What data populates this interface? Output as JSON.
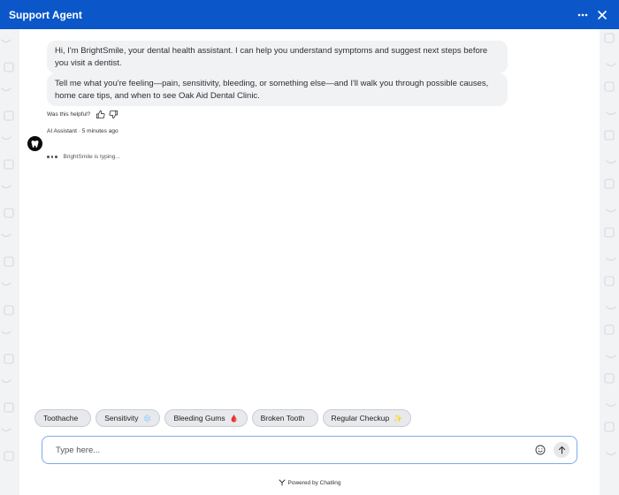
{
  "header": {
    "title": "Support Agent",
    "more_icon": "more-horizontal-icon",
    "close_icon": "close-icon"
  },
  "messages": [
    {
      "text": "Hi, I'm BrightSmile, your dental health assistant. I can help you understand symptoms and suggest next steps before you visit a dentist."
    },
    {
      "text": "Tell me what you're feeling—pain, sensitivity, bleeding, or something else—and I'll walk you through possible causes, home care tips, and when to see Oak Aid Dental Clinic."
    }
  ],
  "feedback": {
    "label": "Was this helpful?"
  },
  "meta": {
    "sender": "AI Assistant · 5 minutes ago"
  },
  "typing": {
    "text": "BrightSmile is typing..."
  },
  "chips": [
    {
      "label": "Toothache",
      "emoji": ""
    },
    {
      "label": "Sensitivity",
      "emoji": "❄️"
    },
    {
      "label": "Bleeding Gums",
      "emoji": "🩸"
    },
    {
      "label": "Broken Tooth",
      "emoji": ""
    },
    {
      "label": "Regular Checkup",
      "emoji": "✨"
    }
  ],
  "input": {
    "placeholder": "Type here..."
  },
  "footer": {
    "text": "Powered by Chatling"
  },
  "colors": {
    "header_bg": "#0b57c9",
    "bubble_bg": "#f1f2f4",
    "input_border": "#7ea9f0"
  }
}
